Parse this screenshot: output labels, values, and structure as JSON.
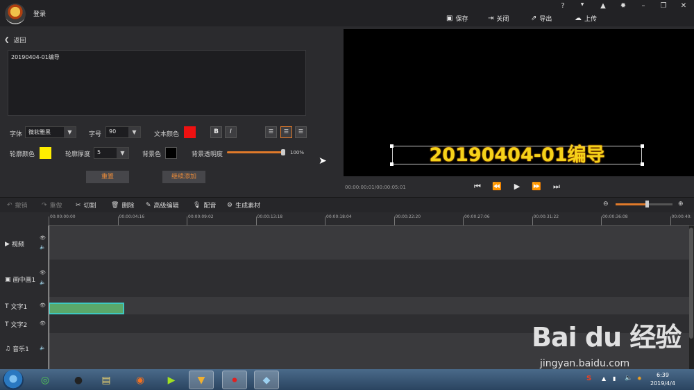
{
  "titlebar": {
    "login": "登录",
    "top_icons": [
      "?",
      "VIP",
      "bell",
      "gear",
      "minimize",
      "restore",
      "close"
    ],
    "actions": [
      {
        "icon": "save-icon",
        "label": "保存"
      },
      {
        "icon": "exit-icon",
        "label": "关闭"
      },
      {
        "icon": "export-icon",
        "label": "导出"
      },
      {
        "icon": "upload-icon",
        "label": "上传"
      }
    ]
  },
  "editor": {
    "back_label": "返回",
    "text_value": "20190404-01编导",
    "font_label": "字体",
    "font_value": "微软雅黑",
    "size_label": "字号",
    "size_value": "90",
    "text_color_label": "文本颜色",
    "text_color": "#ee1111",
    "bold": "B",
    "italic": "I",
    "outline_color_label": "轮廓颜色",
    "outline_color": "#ffee00",
    "outline_width_label": "轮廓厚度",
    "outline_width_value": "5",
    "bg_color_label": "背景色",
    "bg_color": "#000000",
    "bg_opacity_label": "背景透明度",
    "bg_opacity_value": "100%",
    "reset_label": "重置",
    "continue_label": "继续添加"
  },
  "preview": {
    "overlay_text": "20190404-01编导",
    "timecode": "00:00:00:01/00:00:05:01"
  },
  "toolbar": {
    "undo": "撤销",
    "redo": "重做",
    "cut": "切割",
    "delete": "删除",
    "advanced_edit": "高级编辑",
    "dub": "配音",
    "generate": "生成素材"
  },
  "timeline": {
    "ticks": [
      "00:00:00:00",
      "00:00:04:16",
      "00:00:09:02",
      "00:00:13:18",
      "00:00:18:04",
      "00:00:22:20",
      "00:00:27:06",
      "00:00:31:22",
      "00:00:36:08",
      "00:00:40:"
    ],
    "tracks": [
      {
        "name": "视频"
      },
      {
        "name": "画中画1"
      },
      {
        "name": "文字1"
      },
      {
        "name": "文字2"
      },
      {
        "name": "音乐1"
      }
    ]
  },
  "taskbar": {
    "time": "6:39",
    "date": "2019/4/4"
  },
  "watermark": {
    "brand": "Bai du 经验",
    "url": "jingyan.baidu.com"
  }
}
